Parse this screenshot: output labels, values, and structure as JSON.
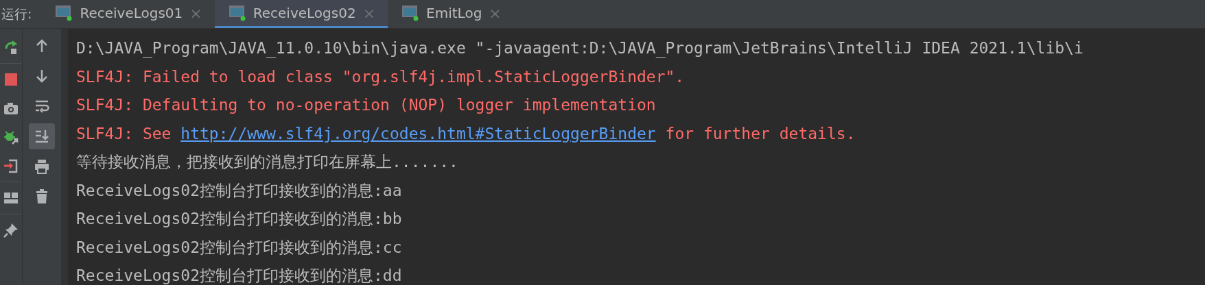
{
  "run_label": "运行:",
  "tabs": [
    {
      "label": "ReceiveLogs01",
      "selected": false,
      "close": "×"
    },
    {
      "label": "ReceiveLogs02",
      "selected": true,
      "close": "×"
    },
    {
      "label": "EmitLog",
      "selected": false,
      "close": "×"
    }
  ],
  "left_toolbar_groups": [
    {
      "items": [
        {
          "kind": "rerun"
        }
      ]
    },
    {
      "items": [
        {
          "kind": "stop"
        },
        {
          "kind": "camera"
        },
        {
          "kind": "debug"
        },
        {
          "kind": "exit"
        }
      ]
    },
    {
      "items": [
        {
          "kind": "layout"
        }
      ]
    },
    {
      "items": [
        {
          "kind": "pin"
        }
      ]
    }
  ],
  "console_toolbar": [
    {
      "kind": "up",
      "selected": false
    },
    {
      "kind": "down",
      "selected": false
    },
    {
      "kind": "wrap",
      "selected": false
    },
    {
      "kind": "scroll-end",
      "selected": true
    },
    {
      "kind": "print",
      "selected": false
    },
    {
      "kind": "trash",
      "selected": false
    }
  ],
  "console": [
    {
      "segments": [
        {
          "kind": "plain",
          "text": "D:\\JAVA_Program\\JAVA_11.0.10\\bin\\java.exe \"-javaagent:D:\\JAVA_Program\\JetBrains\\IntelliJ IDEA 2021.1\\lib\\i"
        }
      ]
    },
    {
      "segments": [
        {
          "kind": "error",
          "text": "SLF4J: Failed to load class \"org.slf4j.impl.StaticLoggerBinder\"."
        }
      ]
    },
    {
      "segments": [
        {
          "kind": "error",
          "text": "SLF4J: Defaulting to no-operation (NOP) logger implementation"
        }
      ]
    },
    {
      "segments": [
        {
          "kind": "error",
          "text": "SLF4J: See "
        },
        {
          "kind": "link",
          "text": "http://www.slf4j.org/codes.html#StaticLoggerBinder"
        },
        {
          "kind": "error",
          "text": " for further details."
        }
      ]
    },
    {
      "segments": [
        {
          "kind": "plain",
          "text": "等待接收消息，把接收到的消息打印在屏幕上......."
        }
      ]
    },
    {
      "segments": [
        {
          "kind": "plain",
          "text": "ReceiveLogs02控制台打印接收到的消息:aa"
        }
      ]
    },
    {
      "segments": [
        {
          "kind": "plain",
          "text": "ReceiveLogs02控制台打印接收到的消息:bb"
        }
      ]
    },
    {
      "segments": [
        {
          "kind": "plain",
          "text": "ReceiveLogs02控制台打印接收到的消息:cc"
        }
      ]
    },
    {
      "segments": [
        {
          "kind": "plain",
          "text": "ReceiveLogs02控制台打印接收到的消息:dd"
        }
      ]
    }
  ]
}
